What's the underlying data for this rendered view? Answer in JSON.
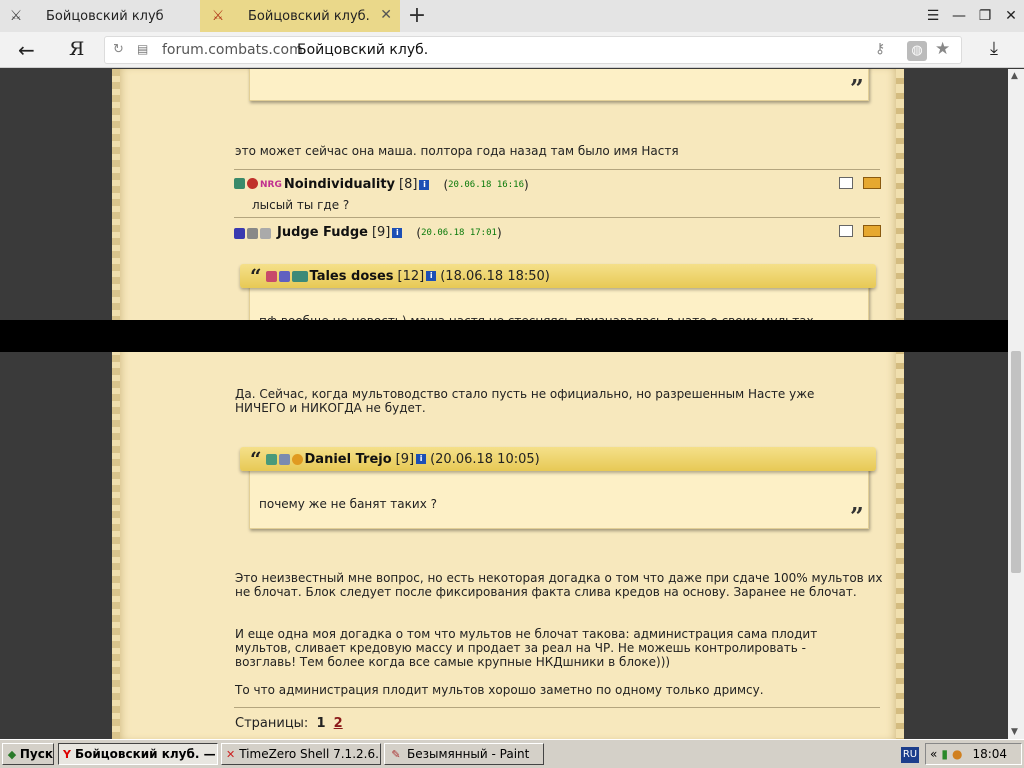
{
  "browser": {
    "tabs": [
      {
        "title": "Бойцовский клуб",
        "active": false
      },
      {
        "title": "Бойцовский клуб.",
        "active": true
      }
    ],
    "yandex_label": "Я",
    "url_domain": "forum.combats.com",
    "url_title": "Бойцовский клуб."
  },
  "page": {
    "post1_text": "это может сейчас она маша. полтора года назад там было имя Настя",
    "post2": {
      "author": "Noindividuality",
      "level": "[8]",
      "date": "20.06.18 16:16",
      "text": "лысый ты где ?"
    },
    "post3": {
      "author": "Judge Fudge",
      "level": "[9]",
      "date": "20.06.18 17:01"
    },
    "quote1": {
      "author": "Tales doses",
      "level": "[12]",
      "date": "(18.06.18 18:50)",
      "text": "пф вообще не новость) маша настя не стесняясь признавалась в чате о своих мультах"
    },
    "para1": "Да. Сейчас, когда мультоводство стало пусть не официально, но разрешенным Насте уже НИЧЕГО и НИКОГДА не будет.",
    "quote2": {
      "author": "Daniel Trejo",
      "level": "[9]",
      "date": "(20.06.18 10:05)",
      "text": "почему же не банят таких ?"
    },
    "para2": "Это неизвестный мне вопрос, но есть некоторая догадка о том что даже при сдаче 100% мультов их не блочат. Блок следует после фиксирования факта слива кредов на основу. Заранее не блочат.",
    "para3": "И еще одна моя догадка о том что мультов не блочат такова: администрация сама плодит мультов, сливает кредовую массу и продает за реал на ЧР. Не можешь контролировать - возглавь! Тем более когда все самые крупные НКДшники в блоке)))",
    "para4": "То что администрация плодит мультов хорошо заметно по одному только дримсу.",
    "pages_label": "Страницы:",
    "pages": [
      "1",
      "2"
    ],
    "nrg_badge": "NRG"
  },
  "taskbar": {
    "start": "Пуск",
    "items": [
      {
        "label": "Бойцовский клуб. — ...",
        "active": true
      },
      {
        "label": "TimeZero Shell 7.1.2.6. ...",
        "active": false
      },
      {
        "label": "Безымянный - Paint",
        "active": false
      }
    ],
    "lang": "RU",
    "time": "18:04"
  },
  "colors": {
    "paper": "#f7e8bd",
    "tab_active": "#ead88a",
    "date_green": "#0a7a0a",
    "link_red": "#8b1a1a"
  }
}
